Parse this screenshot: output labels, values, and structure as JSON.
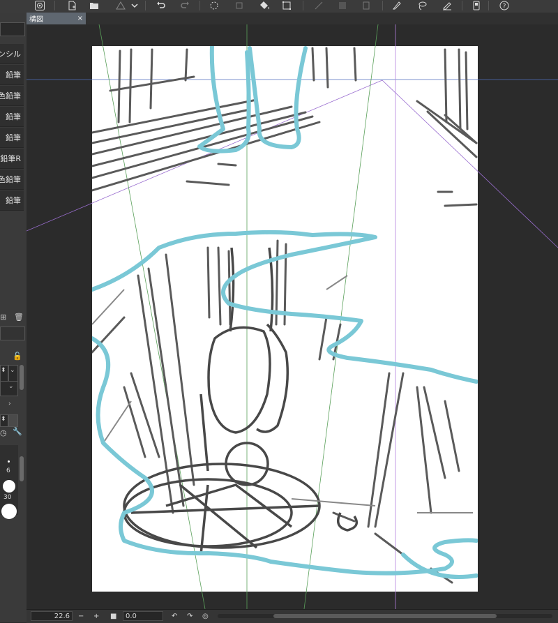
{
  "toolbar": {
    "icons": [
      "spiral-logo-icon",
      "new-file-icon",
      "open-folder-icon",
      "warning-icon",
      "dropdown-arrow-icon",
      "undo-icon",
      "redo-icon",
      "loading-icon",
      "transform-icon",
      "fill-icon",
      "crop-icon",
      "ruler-icon",
      "gradient-icon",
      "clear-icon",
      "edit-icon",
      "lasso-icon",
      "pen-icon",
      "device-icon",
      "help-icon"
    ]
  },
  "tab": {
    "title": "構図",
    "close": "×"
  },
  "brushes": [
    "ンシル",
    "鉛筆",
    "色鉛筆",
    "鉛筆",
    "鉛筆",
    "鉛筆R",
    "色鉛筆",
    "鉛筆"
  ],
  "brush_sizes": {
    "small": "6",
    "large": "30"
  },
  "status": {
    "zoom": "22.6",
    "minus": "−",
    "plus": "+",
    "angle": "0.0"
  },
  "colors": {
    "sketch": "#555555",
    "blue_sketch": "#7ac8d6",
    "guide_purple": "#b480e0",
    "guide_green": "#5aa05a",
    "guide_blue": "#5577bb"
  }
}
